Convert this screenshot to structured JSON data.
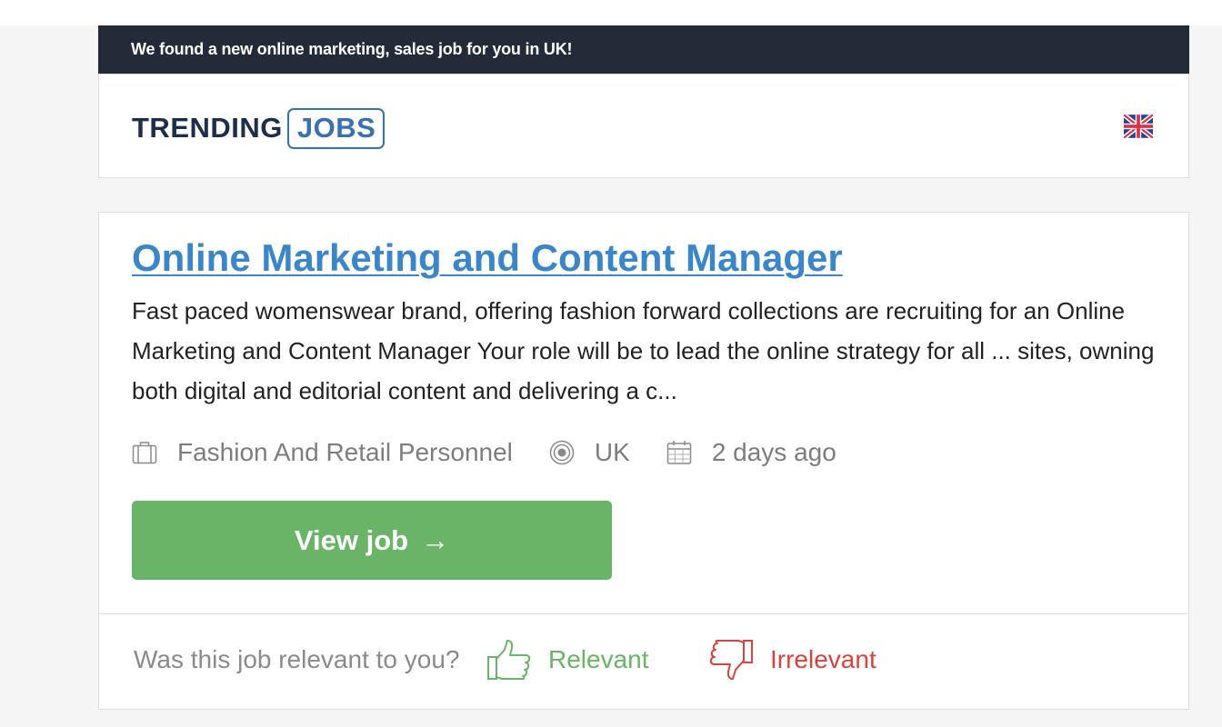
{
  "banner": {
    "text": "We found a new online marketing, sales job for you in UK!"
  },
  "logo": {
    "part1": "TRENDING",
    "part2": "JOBS"
  },
  "header": {
    "flag_icon": "uk-flag-icon"
  },
  "job": {
    "title": "Online Marketing and Content Manager",
    "description": "Fast paced womenswear brand, offering fashion forward collections are recruiting for an Online Marketing and Content Manager Your role will be to lead the online strategy for all ... sites, owning both digital and editorial content and delivering a c...",
    "company": "Fashion And Retail Personnel",
    "location": "UK",
    "posted": "2 days ago",
    "view_button": "View job",
    "view_arrow": "→"
  },
  "feedback": {
    "question": "Was this job relevant to you?",
    "relevant_label": "Relevant",
    "irrelevant_label": "Irrelevant"
  },
  "colors": {
    "banner_bg": "#222b37",
    "title_link": "#3b86c8",
    "button_green": "#6ab467",
    "relevant_green": "#6ab467",
    "irrelevant_red": "#d6443d",
    "logo_dark": "#1d2e4a",
    "logo_blue": "#3a6fb1"
  }
}
